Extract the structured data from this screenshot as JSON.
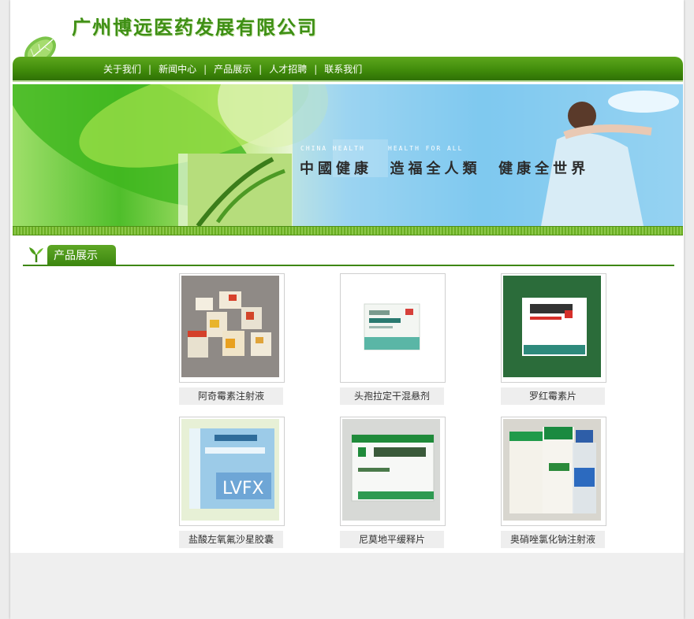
{
  "header": {
    "company_name": "广州博远医药发展有限公司"
  },
  "nav": {
    "items": [
      "关于我们",
      "新闻中心",
      "产品展示",
      "人才招聘",
      "联系我们"
    ],
    "separator": "|"
  },
  "banner": {
    "tag_left": "CHINA HEALTH",
    "tag_right": "HEALTH FOR ALL",
    "slogan": "中國健康  造福全人類  健康全世界"
  },
  "section": {
    "title": "产品展示"
  },
  "products": [
    {
      "name": "阿奇霉素注射液",
      "image": "azithromycin-boxes"
    },
    {
      "name": "头孢拉定干混悬剂",
      "image": "cefradine-box"
    },
    {
      "name": "罗红霉素片",
      "image": "roxithromycin-box"
    },
    {
      "name": "盐酸左氧氟沙星胶囊",
      "image": "levofloxacin-box"
    },
    {
      "name": "尼莫地平缓释片",
      "image": "nimodipine-box"
    },
    {
      "name": "奥硝唑氯化钠注射液",
      "image": "ornidazole-bottle"
    }
  ],
  "colors": {
    "brand_green": "#3e8f14",
    "nav_green": "#4a9515",
    "page_bg": "#efefef"
  }
}
